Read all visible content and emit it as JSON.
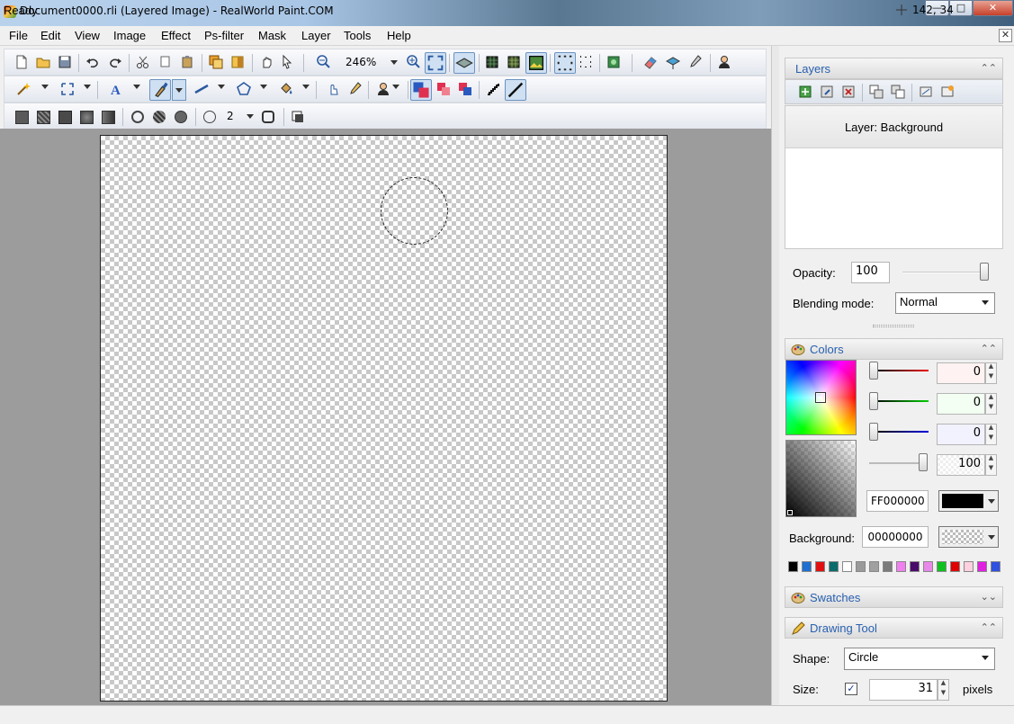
{
  "window": {
    "title": "Document0000.rli (Layered Image) - RealWorld Paint.COM",
    "minimize_glyph": "—",
    "maximize_glyph": "□",
    "close_glyph": "✕"
  },
  "menu": {
    "items": [
      "File",
      "Edit",
      "View",
      "Image",
      "Effect",
      "Ps-filter",
      "Mask",
      "Layer",
      "Tools",
      "Help"
    ],
    "close_glyph": "✕"
  },
  "toolbar": {
    "zoom_value": "246%",
    "brush_size": "2"
  },
  "layers_panel": {
    "title": "Layers",
    "layer_name": "Layer: Background",
    "opacity_label": "Opacity:",
    "opacity_value": "100",
    "opacity_fraction": 1.0,
    "blending_label": "Blending mode:",
    "blending_value": "Normal"
  },
  "colors_panel": {
    "title": "Colors",
    "red_value": "0",
    "green_value": "0",
    "blue_value": "0",
    "alpha_value": "100",
    "foreground_hex": "FF000000",
    "background_label": "Background:",
    "background_hex": "00000000",
    "palette": [
      "#000000",
      "#1e6fd0",
      "#e01010",
      "#0b6b6b",
      "#ffffff",
      "#9a9a9a",
      "#a0a0a0",
      "#7a7a7a",
      "#f07ff0",
      "#4a0a6a",
      "#e888e8",
      "#10c020",
      "#e00000",
      "#ffd0e0",
      "#e020e0",
      "#3050e0"
    ]
  },
  "swatches_panel": {
    "title": "Swatches"
  },
  "drawing_tool_panel": {
    "title": "Drawing Tool",
    "shape_label": "Shape:",
    "shape_value": "Circle",
    "size_label": "Size:",
    "size_value": "31",
    "size_unit": "pixels",
    "size_checked": true
  },
  "status": {
    "text": "Ready",
    "coords": "142, 34"
  }
}
